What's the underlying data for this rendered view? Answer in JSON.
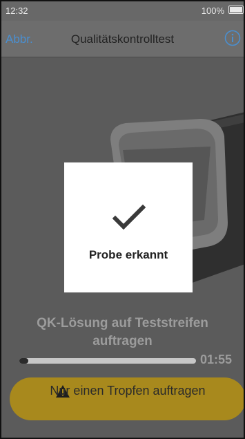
{
  "status_bar": {
    "time": "12:32",
    "battery": "100%"
  },
  "nav": {
    "cancel_label": "Abbr.",
    "title": "Qualitätskontrolltest",
    "info_icon": "info-icon"
  },
  "modal": {
    "icon": "checkmark-icon",
    "label": "Probe erkannt"
  },
  "instruction": {
    "text": "QK-Lösung auf Teststreifen auftragen"
  },
  "progress": {
    "fraction": 0.05,
    "time_remaining": "01:55"
  },
  "warning": {
    "icon": "warning-icon",
    "text": "Nur einen Tropfen auftragen"
  },
  "colors": {
    "accent": "#4a8fd0",
    "warning_bg": "#a8891d",
    "overlay": "#5b5b5b"
  }
}
